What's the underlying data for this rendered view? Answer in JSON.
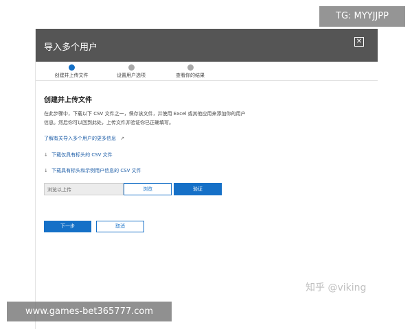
{
  "dialog": {
    "title": "导入多个用户",
    "close_icon": "close-icon",
    "steps": [
      {
        "label": "创建并上传文件",
        "active": true
      },
      {
        "label": "设置用户选项",
        "active": false
      },
      {
        "label": "查看你的结果",
        "active": false
      }
    ],
    "section_title": "创建并上传文件",
    "description": "在此步骤中，下载以下 CSV 文件之一，保存该文件，并使用 Excel 或其他应用来添加你的用户信息。然后你可以回到此处，上传文件并验证你已正确填写。",
    "learn_more_link": "了解有关导入多个用户的更多信息",
    "download_blank_link": "下载仅具有标头的 CSV 文件",
    "download_sample_link": "下载具有标头和示例用户信息的 CSV 文件",
    "file_placeholder": "浏览以上传",
    "browse_label": "浏览",
    "verify_label": "验证",
    "next_label": "下一步",
    "cancel_label": "取消"
  },
  "watermarks": {
    "tg": "TG: MYYJJPP",
    "zhihu": "知乎 @viking",
    "site": "www.games-bet365777.com"
  },
  "colors": {
    "header": "#555555",
    "accent": "#1570c7",
    "inactive_step": "#a9a9a9"
  }
}
